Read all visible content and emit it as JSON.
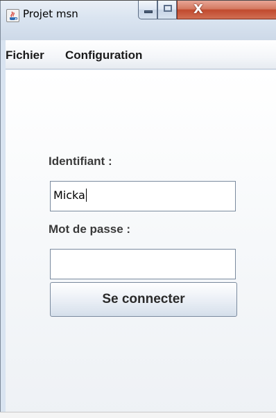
{
  "window": {
    "title": "Projet msn",
    "icon": "java-cup-icon",
    "buttons": {
      "minimize": "minimize-icon",
      "maximize": "maximize-icon",
      "close": "close-icon",
      "close_glyph": "X"
    }
  },
  "menubar": {
    "items": [
      {
        "label": "Fichier"
      },
      {
        "label": "Configuration"
      }
    ]
  },
  "login": {
    "username_label": "Identifiant :",
    "username_value": "Micka",
    "password_label": "Mot de passe :",
    "password_value": "",
    "submit_label": "Se connecter"
  }
}
